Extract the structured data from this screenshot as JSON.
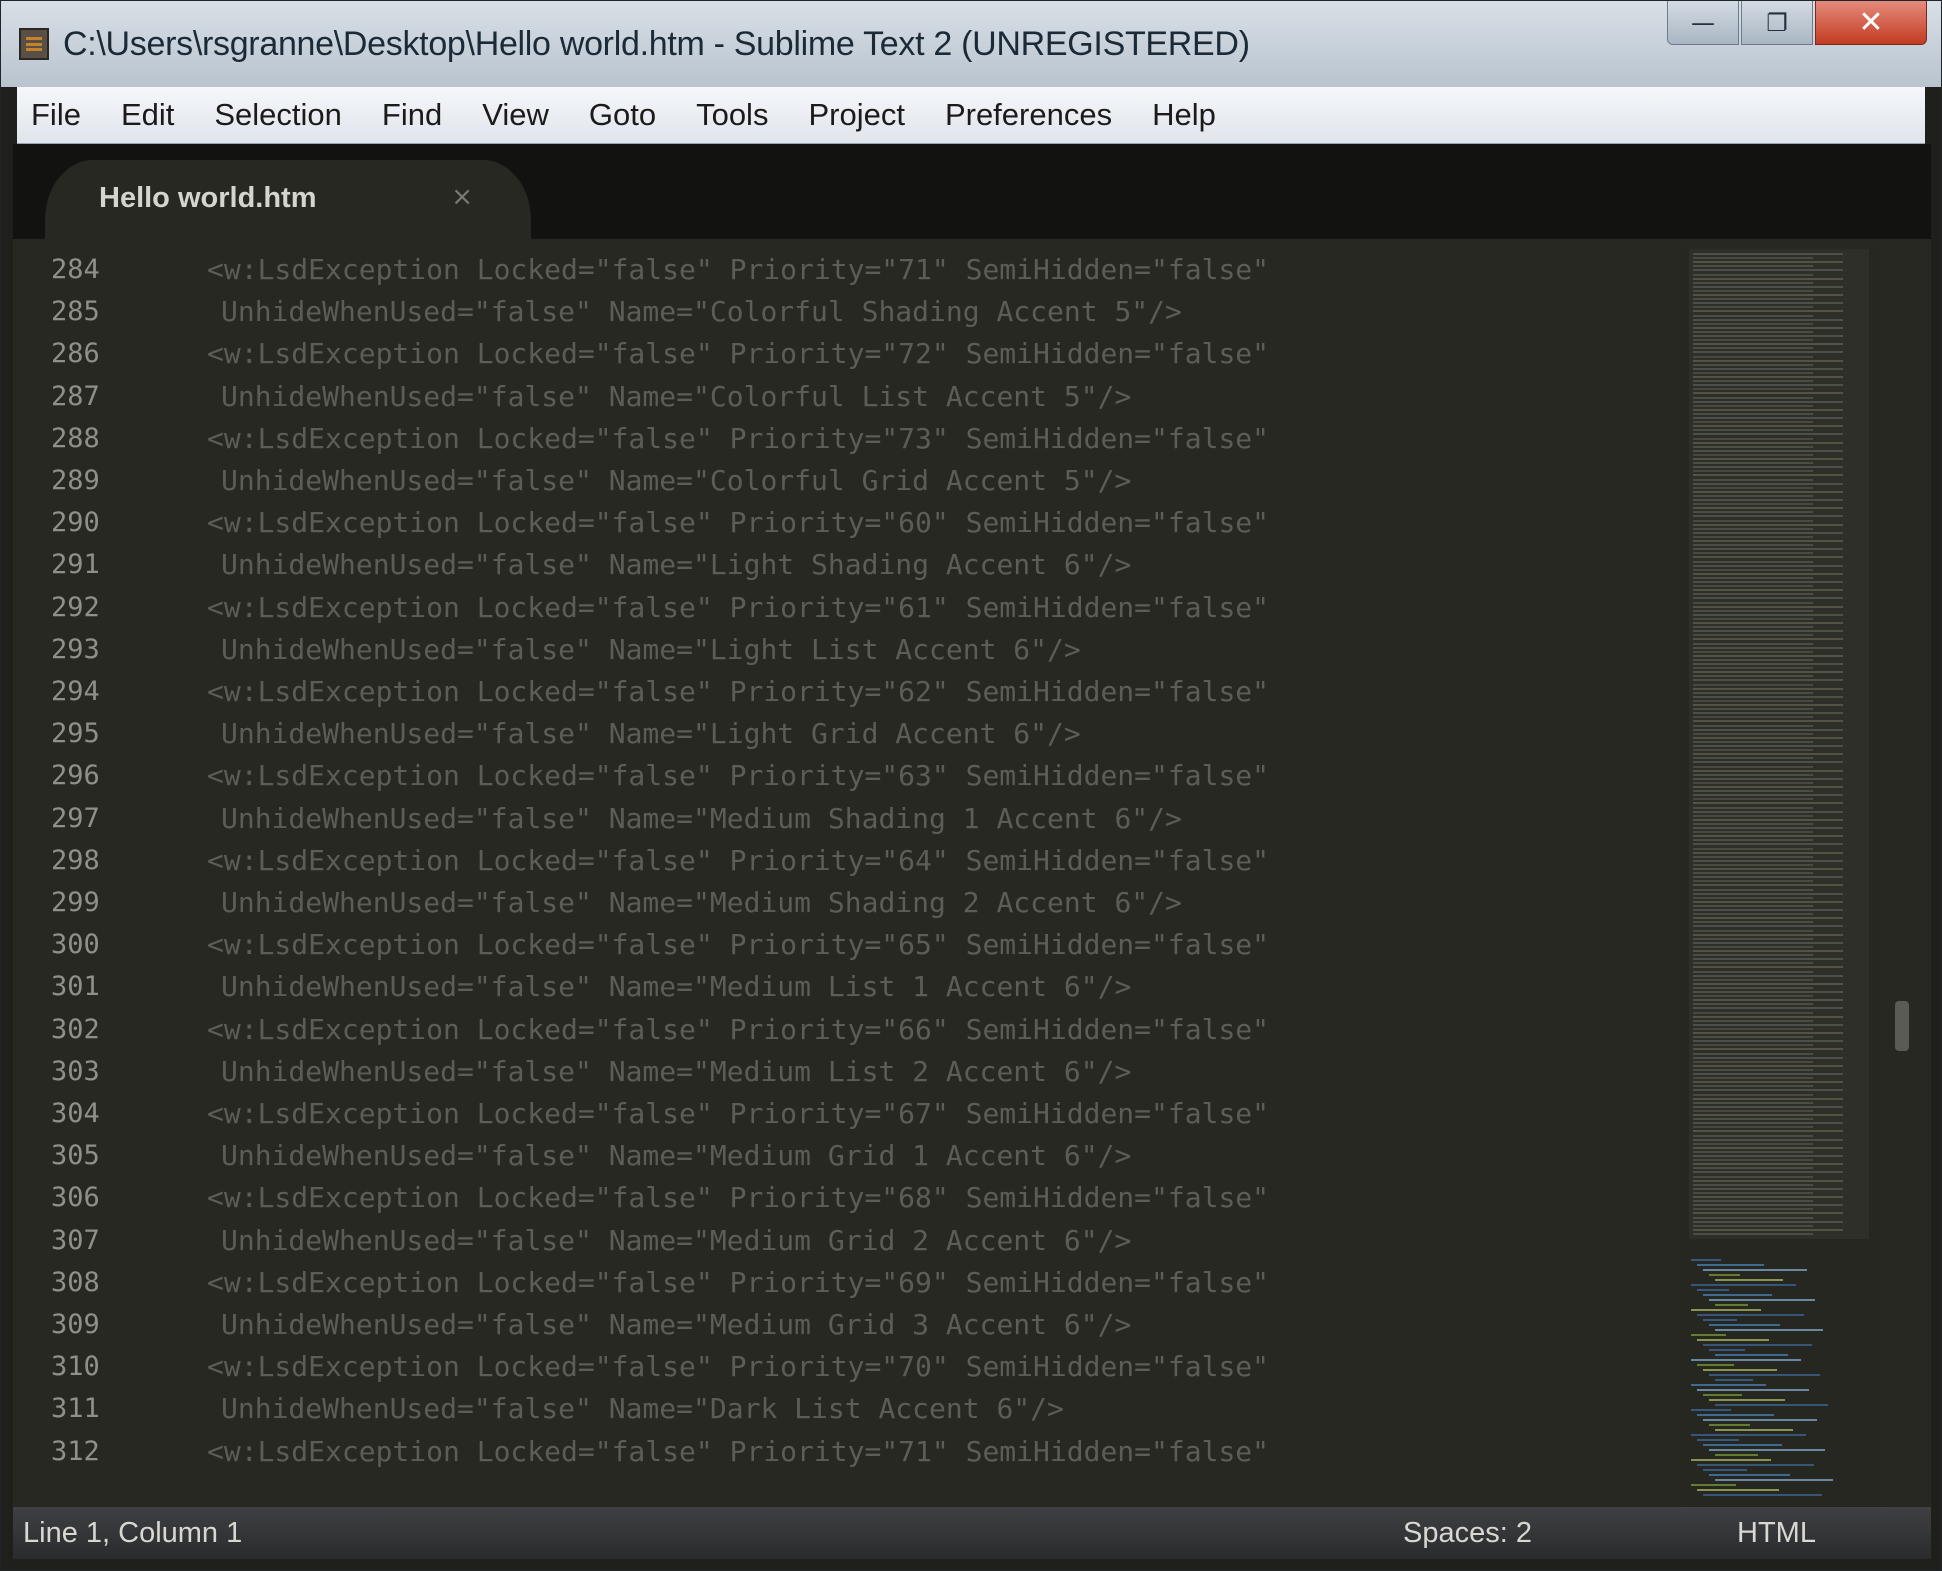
{
  "window": {
    "title": "C:\\Users\\rsgranne\\Desktop\\Hello world.htm - Sublime Text 2 (UNREGISTERED)",
    "controls": {
      "minimize": "—",
      "maximize": "❐",
      "close": "✕"
    }
  },
  "menu": [
    "File",
    "Edit",
    "Selection",
    "Find",
    "View",
    "Goto",
    "Tools",
    "Project",
    "Preferences",
    "Help"
  ],
  "tab": {
    "label": "Hello world.htm",
    "close": "×"
  },
  "editor": {
    "lines": [
      {
        "no": "284",
        "text": "<w:LsdException Locked=\"false\" Priority=\"71\" SemiHidden=\"false\"",
        "cont": false
      },
      {
        "no": "285",
        "text": "UnhideWhenUsed=\"false\" Name=\"Colorful Shading Accent 5\"/>",
        "cont": true
      },
      {
        "no": "286",
        "text": "<w:LsdException Locked=\"false\" Priority=\"72\" SemiHidden=\"false\"",
        "cont": false
      },
      {
        "no": "287",
        "text": "UnhideWhenUsed=\"false\" Name=\"Colorful List Accent 5\"/>",
        "cont": true
      },
      {
        "no": "288",
        "text": "<w:LsdException Locked=\"false\" Priority=\"73\" SemiHidden=\"false\"",
        "cont": false
      },
      {
        "no": "289",
        "text": "UnhideWhenUsed=\"false\" Name=\"Colorful Grid Accent 5\"/>",
        "cont": true
      },
      {
        "no": "290",
        "text": "<w:LsdException Locked=\"false\" Priority=\"60\" SemiHidden=\"false\"",
        "cont": false
      },
      {
        "no": "291",
        "text": "UnhideWhenUsed=\"false\" Name=\"Light Shading Accent 6\"/>",
        "cont": true
      },
      {
        "no": "292",
        "text": "<w:LsdException Locked=\"false\" Priority=\"61\" SemiHidden=\"false\"",
        "cont": false
      },
      {
        "no": "293",
        "text": "UnhideWhenUsed=\"false\" Name=\"Light List Accent 6\"/>",
        "cont": true
      },
      {
        "no": "294",
        "text": "<w:LsdException Locked=\"false\" Priority=\"62\" SemiHidden=\"false\"",
        "cont": false
      },
      {
        "no": "295",
        "text": "UnhideWhenUsed=\"false\" Name=\"Light Grid Accent 6\"/>",
        "cont": true
      },
      {
        "no": "296",
        "text": "<w:LsdException Locked=\"false\" Priority=\"63\" SemiHidden=\"false\"",
        "cont": false
      },
      {
        "no": "297",
        "text": "UnhideWhenUsed=\"false\" Name=\"Medium Shading 1 Accent 6\"/>",
        "cont": true
      },
      {
        "no": "298",
        "text": "<w:LsdException Locked=\"false\" Priority=\"64\" SemiHidden=\"false\"",
        "cont": false
      },
      {
        "no": "299",
        "text": "UnhideWhenUsed=\"false\" Name=\"Medium Shading 2 Accent 6\"/>",
        "cont": true
      },
      {
        "no": "300",
        "text": "<w:LsdException Locked=\"false\" Priority=\"65\" SemiHidden=\"false\"",
        "cont": false
      },
      {
        "no": "301",
        "text": "UnhideWhenUsed=\"false\" Name=\"Medium List 1 Accent 6\"/>",
        "cont": true
      },
      {
        "no": "302",
        "text": "<w:LsdException Locked=\"false\" Priority=\"66\" SemiHidden=\"false\"",
        "cont": false
      },
      {
        "no": "303",
        "text": "UnhideWhenUsed=\"false\" Name=\"Medium List 2 Accent 6\"/>",
        "cont": true
      },
      {
        "no": "304",
        "text": "<w:LsdException Locked=\"false\" Priority=\"67\" SemiHidden=\"false\"",
        "cont": false
      },
      {
        "no": "305",
        "text": "UnhideWhenUsed=\"false\" Name=\"Medium Grid 1 Accent 6\"/>",
        "cont": true
      },
      {
        "no": "306",
        "text": "<w:LsdException Locked=\"false\" Priority=\"68\" SemiHidden=\"false\"",
        "cont": false
      },
      {
        "no": "307",
        "text": "UnhideWhenUsed=\"false\" Name=\"Medium Grid 2 Accent 6\"/>",
        "cont": true
      },
      {
        "no": "308",
        "text": "<w:LsdException Locked=\"false\" Priority=\"69\" SemiHidden=\"false\"",
        "cont": false
      },
      {
        "no": "309",
        "text": "UnhideWhenUsed=\"false\" Name=\"Medium Grid 3 Accent 6\"/>",
        "cont": true
      },
      {
        "no": "310",
        "text": "<w:LsdException Locked=\"false\" Priority=\"70\" SemiHidden=\"false\"",
        "cont": false
      },
      {
        "no": "311",
        "text": "UnhideWhenUsed=\"false\" Name=\"Dark List Accent 6\"/>",
        "cont": true
      },
      {
        "no": "312",
        "text": "<w:LsdException Locked=\"false\" Priority=\"71\" SemiHidden=\"false\"",
        "cont": false
      }
    ]
  },
  "status": {
    "position": "Line 1, Column 1",
    "spaces": "Spaces: 2",
    "syntax": "HTML"
  },
  "colors": {
    "editor_bg": "#272822",
    "code_text": "#5c5d55",
    "line_number": "#8f908a",
    "title_bar": "#c9d2db"
  }
}
